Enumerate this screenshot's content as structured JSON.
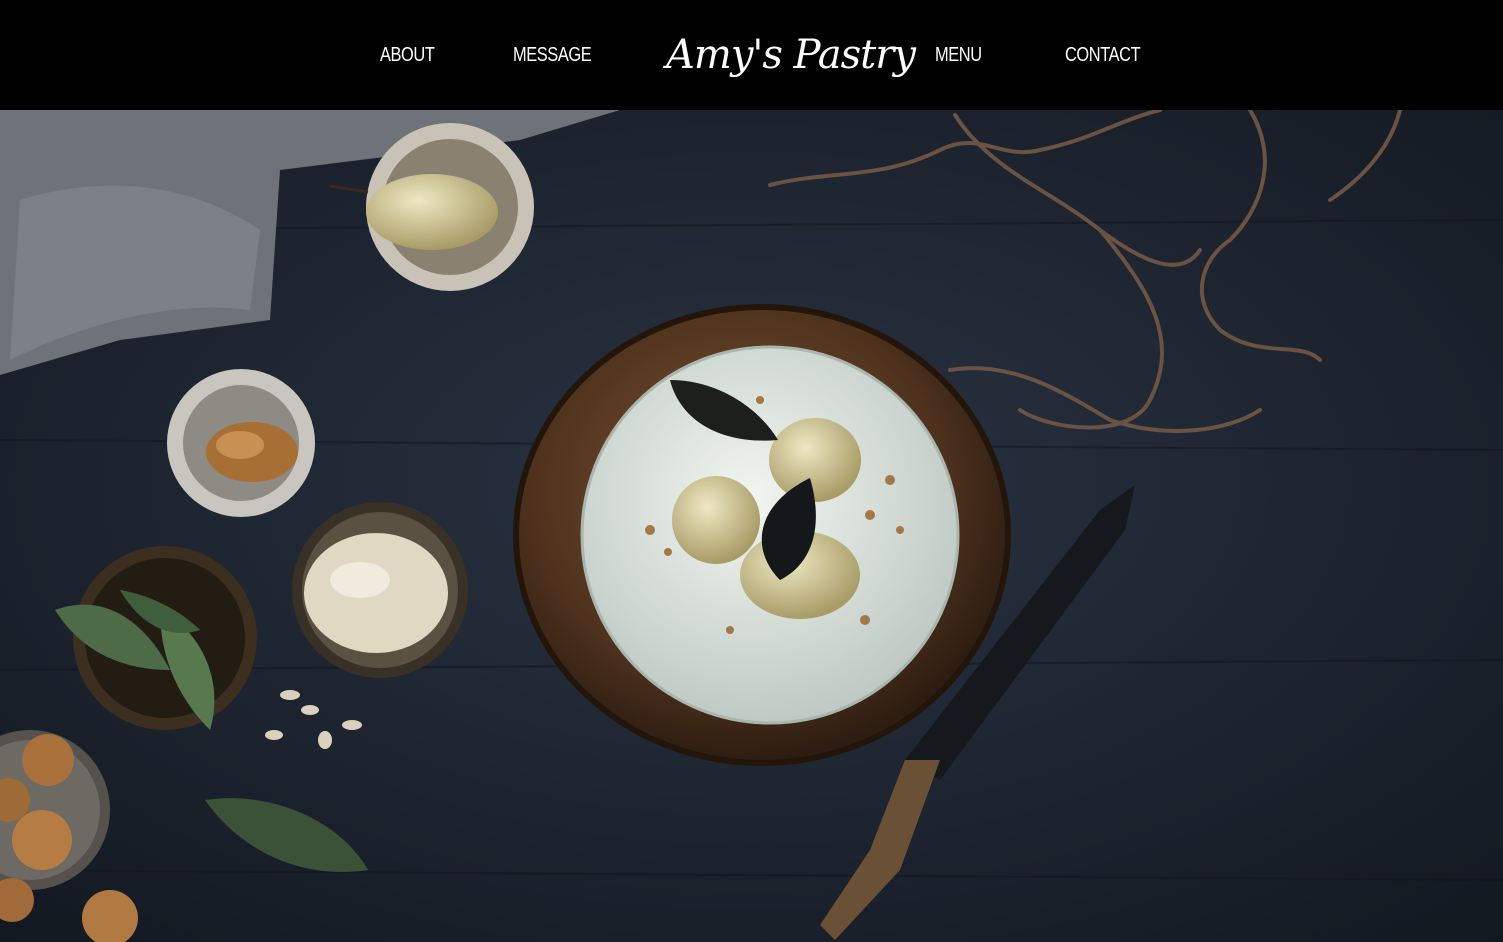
{
  "header": {
    "brand": "Amy's Pastry",
    "nav_left": [
      "ABOUT",
      "MESSAGE"
    ],
    "nav_right": [
      "MENU",
      "CONTACT"
    ]
  },
  "colors": {
    "header_bg": "#000000",
    "nav_text": "#ffffff",
    "table": "#1b2330",
    "cake_frosting": "#dfe6df",
    "wood_board": "#5a3b22"
  },
  "hero": {
    "image_subject": "overhead-cake-with-poached-pears-on-dark-table",
    "icons": [
      "pear-bowl",
      "crumble-bowl",
      "almond-bowl",
      "bay-leaf-bowl",
      "cookie-plate",
      "cake-knife",
      "branch",
      "linen-cloth"
    ]
  }
}
